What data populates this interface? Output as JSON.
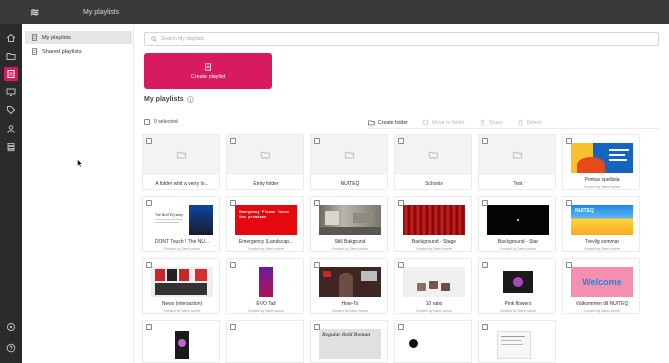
{
  "topbar": {
    "logo_glyph": "≋",
    "title": "My playlists"
  },
  "rail": {
    "icons": [
      "home-icon",
      "folder-icon",
      "playlist-icon",
      "screen-icon",
      "tag-icon",
      "users-icon",
      "layers-icon",
      "settings-icon",
      "help-icon"
    ],
    "active": "playlist-icon",
    "accent": "#d81b60"
  },
  "left_nav": {
    "items": [
      {
        "label": "My playlists",
        "icon": "playlist-icon",
        "selected": true
      },
      {
        "label": "Shared playlists",
        "icon": "shared-playlist-icon",
        "selected": false
      }
    ]
  },
  "search": {
    "placeholder": "Search My playlists"
  },
  "create_playlist": {
    "label": "Create playlist",
    "color": "#d81b60"
  },
  "section": {
    "title": "My playlists"
  },
  "selection": {
    "label": "0 selected"
  },
  "toolbar": {
    "create_folder": "Create folder",
    "move_to_folder": "Move to folder",
    "share": "Share",
    "delete": "Delete"
  },
  "cards": [
    {
      "name": "A folder whit a verry lo...",
      "type": "folder"
    },
    {
      "name": "Emty folder",
      "type": "folder"
    },
    {
      "name": "NUITEQ",
      "type": "folder"
    },
    {
      "name": "Schools",
      "type": "folder"
    },
    {
      "name": "Test",
      "type": "folder"
    },
    {
      "name": "Pontus spellista",
      "by": "Created by Sanni somer",
      "thumb": "pontus"
    },
    {
      "name": "DONT Touch ! The NU...",
      "by": "Created by Sanni somer",
      "thumb": "story",
      "thumb_text": "The NUITEQ story"
    },
    {
      "name": "Emergency (Landscap...",
      "by": "Created by Sanni somer",
      "thumb": "emergency",
      "thumb_text": "Emergency Please leave the premises"
    },
    {
      "name": "Still Bakgrund",
      "by": "Created by Sanni somer",
      "thumb": "room"
    },
    {
      "name": "Background - Stage",
      "by": "Created by Sanni somer",
      "thumb": "stage"
    },
    {
      "name": "Background - Star",
      "by": "Created by Sanni somer",
      "thumb": "star"
    },
    {
      "name": "Trevlig sommar",
      "by": "Created by Sanni somer",
      "thumb": "summer",
      "thumb_text": "NUITEQ"
    },
    {
      "name": "News (interaction)",
      "by": "Created by Sanni somer",
      "thumb": "news"
    },
    {
      "name": "EVO Tall",
      "by": "Created by Sanni somer",
      "thumb": "evo"
    },
    {
      "name": "How-To",
      "by": "Created by Sanni somer",
      "thumb": "howto"
    },
    {
      "name": "10 ratio",
      "by": "Created by Sanni somer",
      "thumb": "dice"
    },
    {
      "name": "Pink flowers",
      "by": "Created by Sanni somer",
      "thumb": "flowers"
    },
    {
      "name": "Välkommen till NUITEQ",
      "by": "Created by Sanni somer",
      "thumb": "welcome",
      "thumb_text": "Welcome"
    },
    {
      "name": "",
      "thumb": "flowers2"
    },
    {
      "name": "",
      "thumb": "blank"
    },
    {
      "name": "",
      "thumb": "type",
      "thumb_text": "Regular Bold Roman"
    },
    {
      "name": "",
      "thumb": "dot"
    },
    {
      "name": "",
      "thumb": "doc"
    },
    {
      "name": "",
      "thumb": "none"
    }
  ]
}
